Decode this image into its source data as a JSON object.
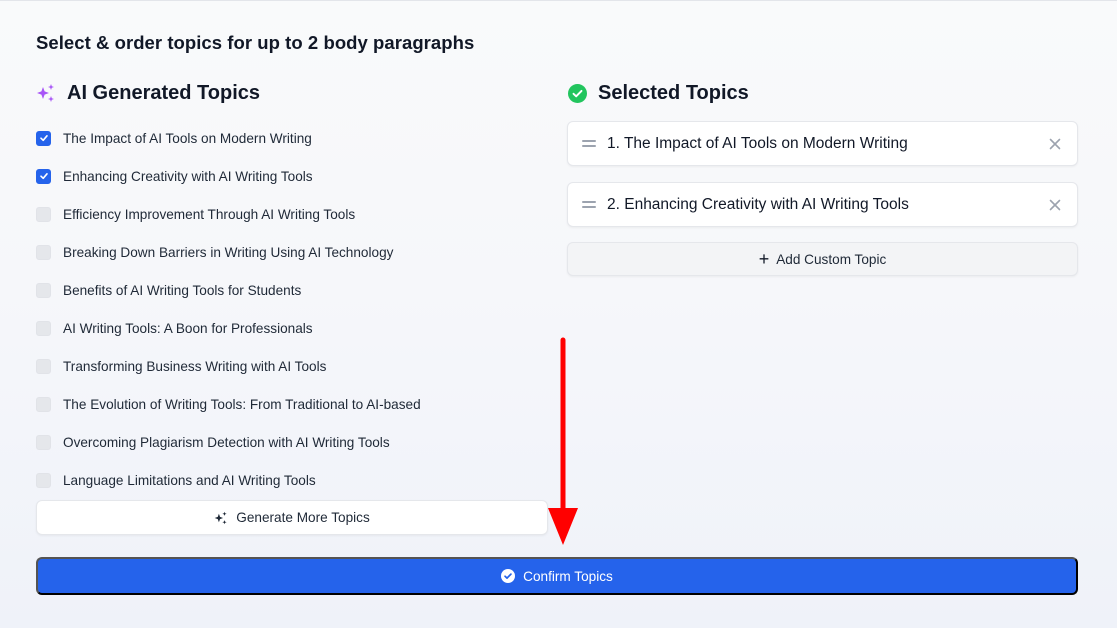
{
  "page": {
    "title": "Select & order topics for up to 2 body paragraphs"
  },
  "ai_topics": {
    "heading": "AI Generated Topics",
    "icon": "sparkles-icon",
    "items": [
      {
        "label": "The Impact of AI Tools on Modern Writing",
        "checked": true
      },
      {
        "label": "Enhancing Creativity with AI Writing Tools",
        "checked": true
      },
      {
        "label": "Efficiency Improvement Through AI Writing Tools",
        "checked": false
      },
      {
        "label": "Breaking Down Barriers in Writing Using AI Technology",
        "checked": false
      },
      {
        "label": "Benefits of AI Writing Tools for Students",
        "checked": false
      },
      {
        "label": "AI Writing Tools: A Boon for Professionals",
        "checked": false
      },
      {
        "label": "Transforming Business Writing with AI Tools",
        "checked": false
      },
      {
        "label": "The Evolution of Writing Tools: From Traditional to AI-based",
        "checked": false
      },
      {
        "label": "Overcoming Plagiarism Detection with AI Writing Tools",
        "checked": false
      },
      {
        "label": "Language Limitations and AI Writing Tools",
        "checked": false
      }
    ],
    "generate_more_label": "Generate More Topics"
  },
  "selected_topics": {
    "heading": "Selected Topics",
    "icon": "check-circle-icon",
    "items": [
      {
        "label": "1. The Impact of AI Tools on Modern Writing"
      },
      {
        "label": "2. Enhancing Creativity with AI Writing Tools"
      }
    ],
    "add_custom_label": "Add Custom Topic",
    "add_custom_icon": "+"
  },
  "confirm": {
    "label": "Confirm Topics",
    "icon": "check-circle-icon"
  },
  "colors": {
    "primary": "#2563eb",
    "success": "#22c55e",
    "sparkle": "#a855f7",
    "annotation": "#ff0000"
  },
  "annotation": {
    "type": "arrow",
    "direction": "down",
    "points_to": "confirm-topics-button"
  }
}
